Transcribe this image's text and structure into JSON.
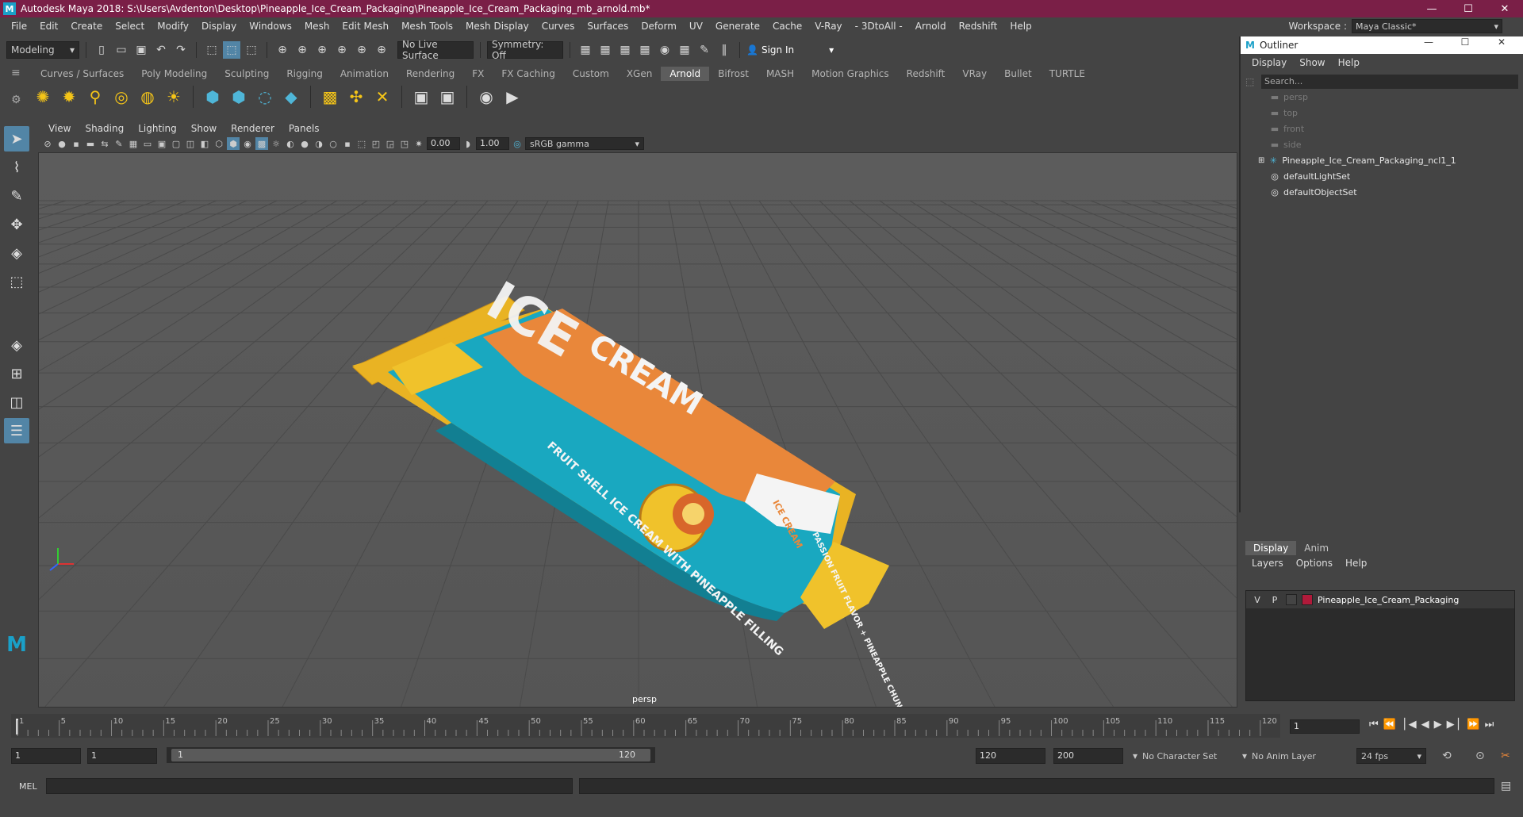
{
  "titlebar": {
    "title": "Autodesk Maya 2018: S:\\Users\\Avdenton\\Desktop\\Pineapple_Ice_Cream_Packaging\\Pineapple_Ice_Cream_Packaging_mb_arnold.mb*",
    "logo": "M",
    "min": "—",
    "max": "☐",
    "close": "✕"
  },
  "menubar": {
    "items": [
      "File",
      "Edit",
      "Create",
      "Select",
      "Modify",
      "Display",
      "Windows",
      "Mesh",
      "Edit Mesh",
      "Mesh Tools",
      "Mesh Display",
      "Curves",
      "Surfaces",
      "Deform",
      "UV",
      "Generate",
      "Cache",
      "V-Ray",
      "- 3DtoAll -",
      "Arnold",
      "Redshift",
      "Help"
    ],
    "workspace_label": "Workspace :",
    "workspace_value": "Maya Classic*"
  },
  "statusline": {
    "mode": "Modeling",
    "live_surface": "No Live Surface",
    "symmetry": "Symmetry: Off",
    "sign_in": "Sign In"
  },
  "shelf": {
    "tabs": [
      "Curves / Surfaces",
      "Poly Modeling",
      "Sculpting",
      "Rigging",
      "Animation",
      "Rendering",
      "FX",
      "FX Caching",
      "Custom",
      "XGen",
      "Arnold",
      "Bifrost",
      "MASH",
      "Motion Graphics",
      "Redshift",
      "VRay",
      "Bullet",
      "TURTLE"
    ],
    "active": "Arnold"
  },
  "viewport": {
    "menus": [
      "View",
      "Shading",
      "Lighting",
      "Show",
      "Renderer",
      "Panels"
    ],
    "exposure": "0.00",
    "gamma": "1.00",
    "color_space": "sRGB gamma",
    "camera_label": "persp",
    "package": {
      "brand_top": "ICE",
      "brand_main": "CREAM",
      "badge": "ICE CREAM",
      "side_text": "FRUIT SHELL ICE CREAM WITH PINEAPPLE FILLING",
      "flavor": "PASSION FRUIT FLAVOR + PINEAPPLE CHUNKS"
    }
  },
  "outliner": {
    "title": "Outliner",
    "menus": [
      "Display",
      "Show",
      "Help"
    ],
    "search_placeholder": "Search...",
    "items": [
      {
        "label": "persp",
        "icon": "camera-icon",
        "dim": true
      },
      {
        "label": "top",
        "icon": "camera-icon",
        "dim": true
      },
      {
        "label": "front",
        "icon": "camera-icon",
        "dim": true
      },
      {
        "label": "side",
        "icon": "camera-icon",
        "dim": true
      },
      {
        "label": "Pineapple_Ice_Cream_Packaging_ncl1_1",
        "icon": "group-icon",
        "dim": false
      },
      {
        "label": "defaultLightSet",
        "icon": "set-icon",
        "dim": false
      },
      {
        "label": "defaultObjectSet",
        "icon": "set-icon",
        "dim": false
      }
    ]
  },
  "layer_editor": {
    "tabs": [
      "Display",
      "Anim"
    ],
    "menus": [
      "Layers",
      "Options",
      "Help"
    ],
    "layer": {
      "v": "V",
      "p": "P",
      "name": "Pineapple_Ice_Cream_Packaging",
      "color": "#b01a3a"
    }
  },
  "timeline": {
    "ticks": [
      "1",
      "5",
      "10",
      "15",
      "20",
      "25",
      "30",
      "35",
      "40",
      "45",
      "50",
      "55",
      "60",
      "65",
      "70",
      "75",
      "80",
      "85",
      "90",
      "95",
      "100",
      "105",
      "110",
      "115",
      "120"
    ],
    "current_frame": "1"
  },
  "range": {
    "start": "1",
    "playback_start": "1",
    "slider_start": "1",
    "slider_end": "120",
    "playback_end": "120",
    "end": "200",
    "character_set": "No Character Set",
    "anim_layer": "No Anim Layer",
    "fps": "24 fps"
  },
  "mel": {
    "label": "MEL"
  }
}
